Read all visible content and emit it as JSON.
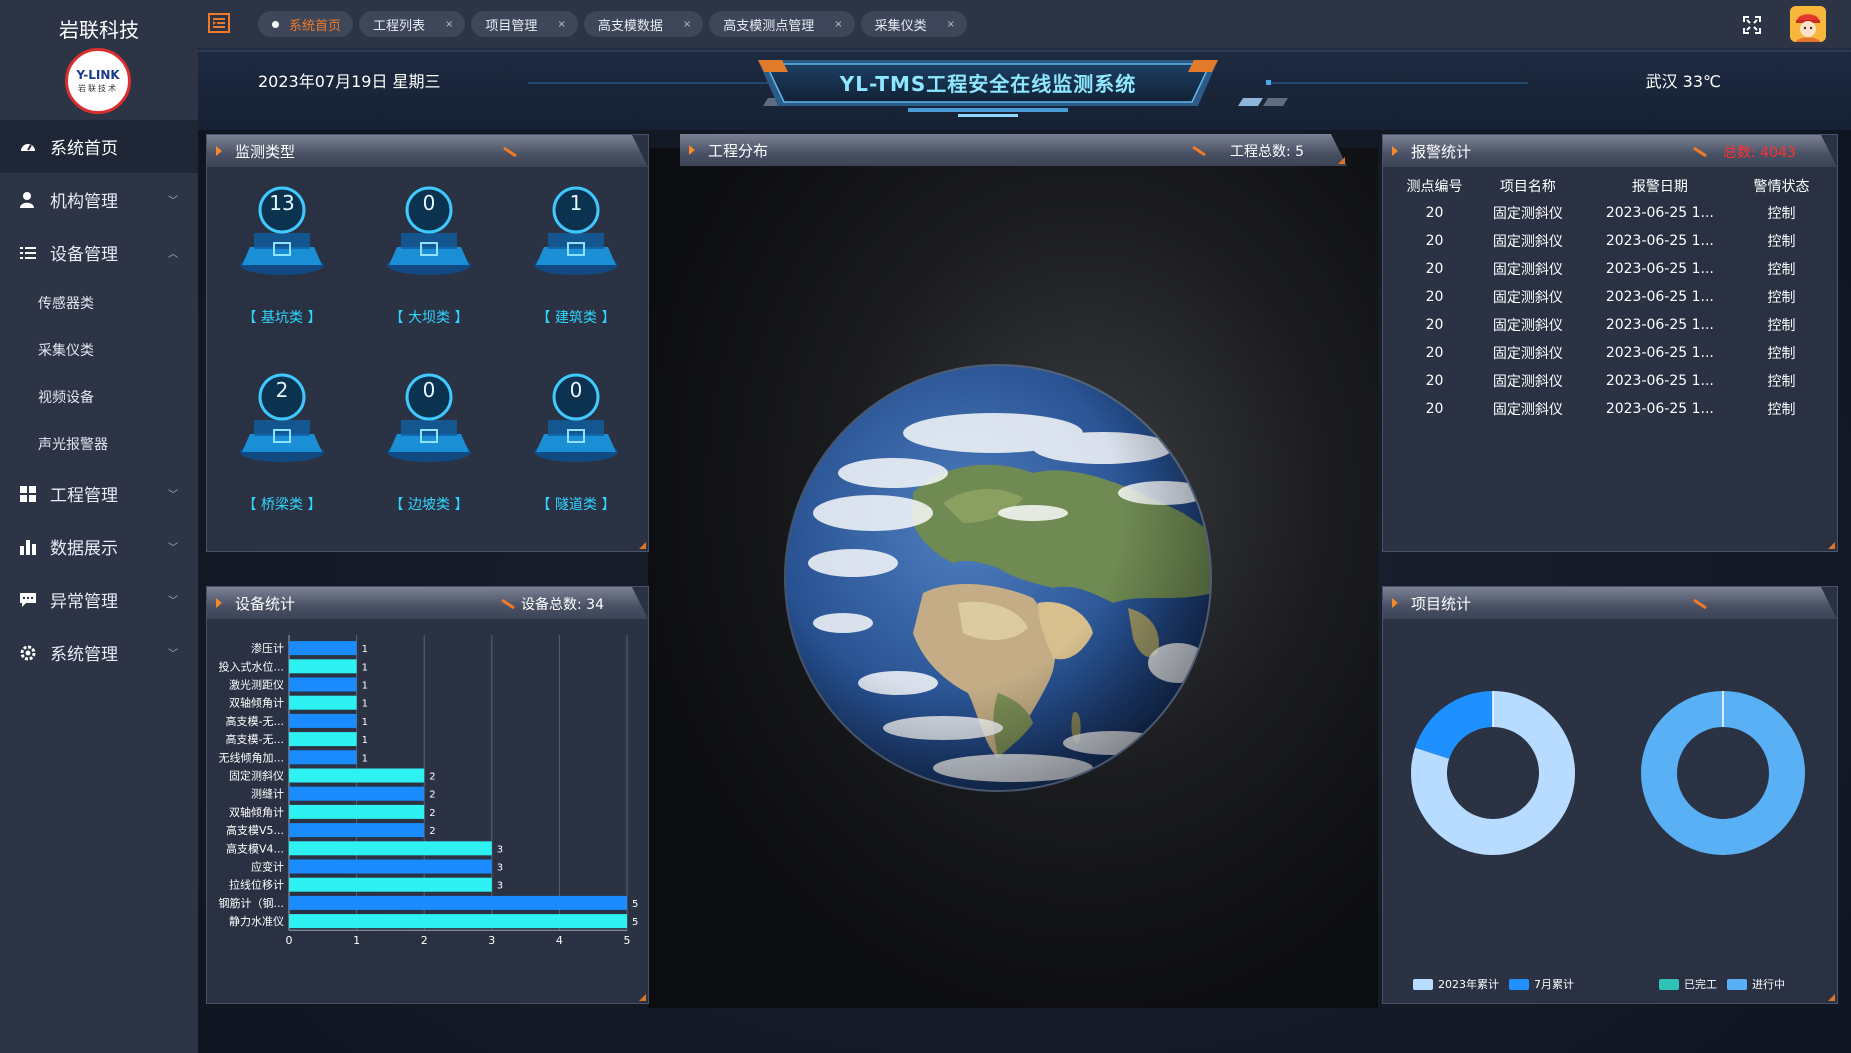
{
  "sidebar": {
    "brand_title": "岩联科技",
    "logo_main": "Y-LINK",
    "logo_sub": "岩联技术",
    "items": [
      {
        "label": "系统首页"
      },
      {
        "label": "机构管理"
      },
      {
        "label": "设备管理"
      },
      {
        "label": "工程管理"
      },
      {
        "label": "数据展示"
      },
      {
        "label": "异常管理"
      },
      {
        "label": "系统管理"
      }
    ],
    "subitems": [
      {
        "label": "传感器类"
      },
      {
        "label": "采集仪类"
      },
      {
        "label": "视频设备"
      },
      {
        "label": "声光报警器"
      }
    ]
  },
  "tabs": [
    {
      "label": "系统首页",
      "close": ""
    },
    {
      "label": "工程列表",
      "close": "×"
    },
    {
      "label": "项目管理",
      "close": "×"
    },
    {
      "label": "高支模数据",
      "close": "×"
    },
    {
      "label": "高支模测点管理",
      "close": "×"
    },
    {
      "label": "采集仪类",
      "close": "×"
    }
  ],
  "header": {
    "date": "2023年07月19日 星期三",
    "title": "YL-TMS工程安全在线监测系统",
    "weather": "武汉 33℃"
  },
  "monitor_types": {
    "title": "监测类型",
    "items": [
      {
        "count": "13",
        "label": "【 基坑类 】"
      },
      {
        "count": "0",
        "label": "【 大坝类 】"
      },
      {
        "count": "1",
        "label": "【 建筑类 】"
      },
      {
        "count": "2",
        "label": "【 桥梁类 】"
      },
      {
        "count": "0",
        "label": "【 边坡类 】"
      },
      {
        "count": "0",
        "label": "【 隧道类 】"
      }
    ]
  },
  "project_distribution": {
    "title": "工程分布",
    "total_label": "工程总数: 5"
  },
  "alarm_stats": {
    "title": "报警统计",
    "total_label": "总数: 4043",
    "columns": [
      "测点编号",
      "项目名称",
      "报警日期",
      "警情状态"
    ],
    "rows": [
      {
        "id": "20",
        "name": "固定测斜仪",
        "date": "2023-06-25 1...",
        "status": "控制"
      },
      {
        "id": "20",
        "name": "固定测斜仪",
        "date": "2023-06-25 1...",
        "status": "控制"
      },
      {
        "id": "20",
        "name": "固定测斜仪",
        "date": "2023-06-25 1...",
        "status": "控制"
      },
      {
        "id": "20",
        "name": "固定测斜仪",
        "date": "2023-06-25 1...",
        "status": "控制"
      },
      {
        "id": "20",
        "name": "固定测斜仪",
        "date": "2023-06-25 1...",
        "status": "控制"
      },
      {
        "id": "20",
        "name": "固定测斜仪",
        "date": "2023-06-25 1...",
        "status": "控制"
      },
      {
        "id": "20",
        "name": "固定测斜仪",
        "date": "2023-06-25 1...",
        "status": "控制"
      },
      {
        "id": "20",
        "name": "固定测斜仪",
        "date": "2023-06-25 1...",
        "status": "控制"
      }
    ]
  },
  "device_stats": {
    "title": "设备统计",
    "total_label": "设备总数: 34"
  },
  "project_stats": {
    "title": "项目统计",
    "legend_left": [
      "2023年累计",
      "7月累计"
    ],
    "legend_right": [
      "已完工",
      "进行中"
    ]
  },
  "colors": {
    "accent_orange": "#f07a2a",
    "cyan_label": "#2fd6ff",
    "alarm_red": "#ff3030",
    "bar_blue": "#1a8cff",
    "bar_cyan": "#2ef2f2",
    "donut_light": "#b8dcff",
    "donut_blue": "#1e90ff",
    "donut_mid": "#5ab0f5",
    "legend_teal": "#2fc3b8"
  },
  "chart_data": [
    {
      "type": "bar",
      "orientation": "horizontal",
      "categories": [
        "渗压计",
        "投入式水位...",
        "激光测距仪",
        "双轴倾角计",
        "高支模-无...",
        "高支模-无...",
        "无线倾角加...",
        "固定测斜仪",
        "测缝计",
        "双轴倾角计",
        "高支模V5...",
        "高支模V4...",
        "应变计",
        "拉线位移计",
        "钢筋计（钢...",
        "静力水准仪"
      ],
      "values": [
        1,
        1,
        1,
        1,
        1,
        1,
        1,
        2,
        2,
        2,
        2,
        3,
        3,
        3,
        5,
        5
      ],
      "bar_colors": [
        "#1a8cff",
        "#2ef2f2",
        "#1a8cff",
        "#2ef2f2",
        "#1a8cff",
        "#2ef2f2",
        "#1a8cff",
        "#2ef2f2",
        "#1a8cff",
        "#2ef2f2",
        "#1a8cff",
        "#2ef2f2",
        "#1a8cff",
        "#2ef2f2",
        "#1a8cff",
        "#2ef2f2"
      ],
      "xlim": [
        0,
        5
      ],
      "xticks": [
        0,
        1,
        2,
        3,
        4,
        5
      ],
      "grid": true
    },
    {
      "type": "pie",
      "variant": "donut",
      "labels": [
        "2023年累计",
        "7月累计"
      ],
      "values": [
        80,
        20
      ],
      "colors": [
        "#b8dcff",
        "#1e90ff"
      ]
    },
    {
      "type": "pie",
      "variant": "donut",
      "labels": [
        "已完工",
        "进行中"
      ],
      "values": [
        0,
        100
      ],
      "colors": [
        "#2fc3b8",
        "#5ab0f5"
      ]
    }
  ]
}
